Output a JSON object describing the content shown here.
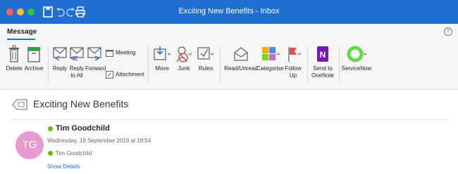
{
  "window": {
    "title": "Exciting New Benefits - Inbox",
    "accent": "#1f6fd1"
  },
  "ribbon_tabs": {
    "active": "Message"
  },
  "ribbon": {
    "delete": "Delete",
    "archive": "Archive",
    "reply": "Reply",
    "reply_all": "Reply\nto All",
    "forward": "Forward",
    "meeting": "Meeting",
    "attachment": "Attachment",
    "move": "Move",
    "junk": "Junk",
    "rules": "Rules",
    "read_unread": "Read/Unread",
    "categorise": "Categorise",
    "follow_up": "Follow\nUp",
    "send_to_onenote": "Send to\nOneNote",
    "servicenow": "ServiceNow"
  },
  "message": {
    "subject": "Exciting New Benefits",
    "sender": "Tim Goodchild",
    "avatar_initials": "TG",
    "avatar_color": "#e99ad3",
    "sent": "Wednesday, 18 September 2019 at 18:54",
    "to": "Tim Goodchild",
    "show_details": "Show Details"
  }
}
